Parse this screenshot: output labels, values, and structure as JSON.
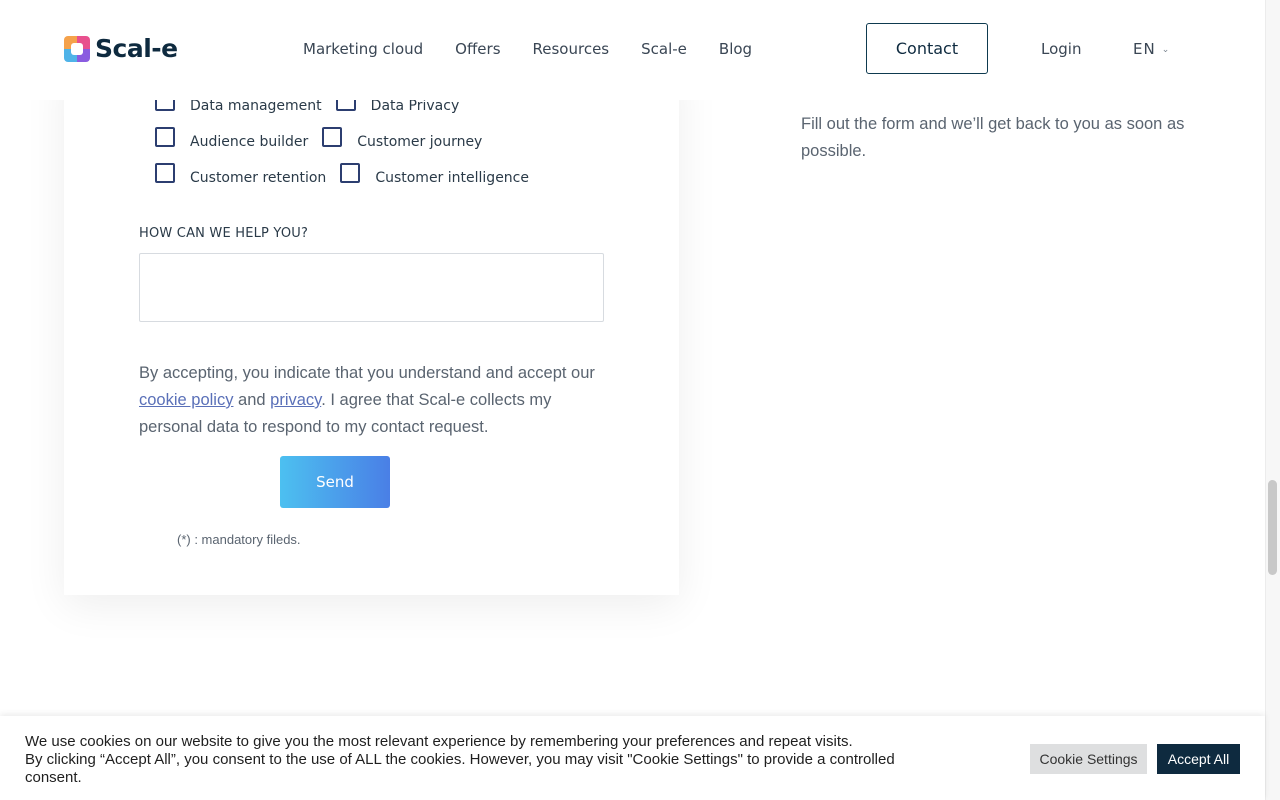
{
  "header": {
    "logo_text": "Scal-e",
    "nav": [
      "Marketing cloud",
      "Offers",
      "Resources",
      "Scal-e",
      "Blog"
    ],
    "contact_label": "Contact",
    "login_label": "Login",
    "lang_label": "EN"
  },
  "form": {
    "checkbox_rows": [
      [
        "Data management",
        "Data Privacy"
      ],
      [
        "Audience builder",
        "Customer journey"
      ],
      [
        "Customer retention",
        "Customer intelligence"
      ]
    ],
    "help_label": "HOW CAN WE HELP YOU?",
    "help_value": "",
    "consent_before": "By accepting, you indicate that you understand and accept our ",
    "cookie_policy_link": "cookie policy",
    "consent_and": " and ",
    "privacy_link": "privacy",
    "consent_after": ". I agree that Scal-e collects my personal data to respond to my contact request.",
    "send_label": "Send",
    "mandatory_note": "(*) : mandatory fileds."
  },
  "intro": {
    "text": "Fill out the form and we’ll get back to you as soon as possible."
  },
  "cookie_bar": {
    "text_line1": "We use cookies on our website to give you the most relevant experience by remembering your preferences and repeat visits.",
    "text_line2": "By clicking “Accept All”, you consent to the use of ALL the cookies. However, you may visit \"Cookie Settings\" to provide a controlled consent.",
    "settings_label": "Cookie Settings",
    "accept_label": "Accept All"
  },
  "colors": {
    "brand_dark": "#0e2a3f",
    "send_gradient_start": "#4cc0f0",
    "send_gradient_end": "#4a7fe6",
    "checkbox_border": "#2c3e70"
  }
}
